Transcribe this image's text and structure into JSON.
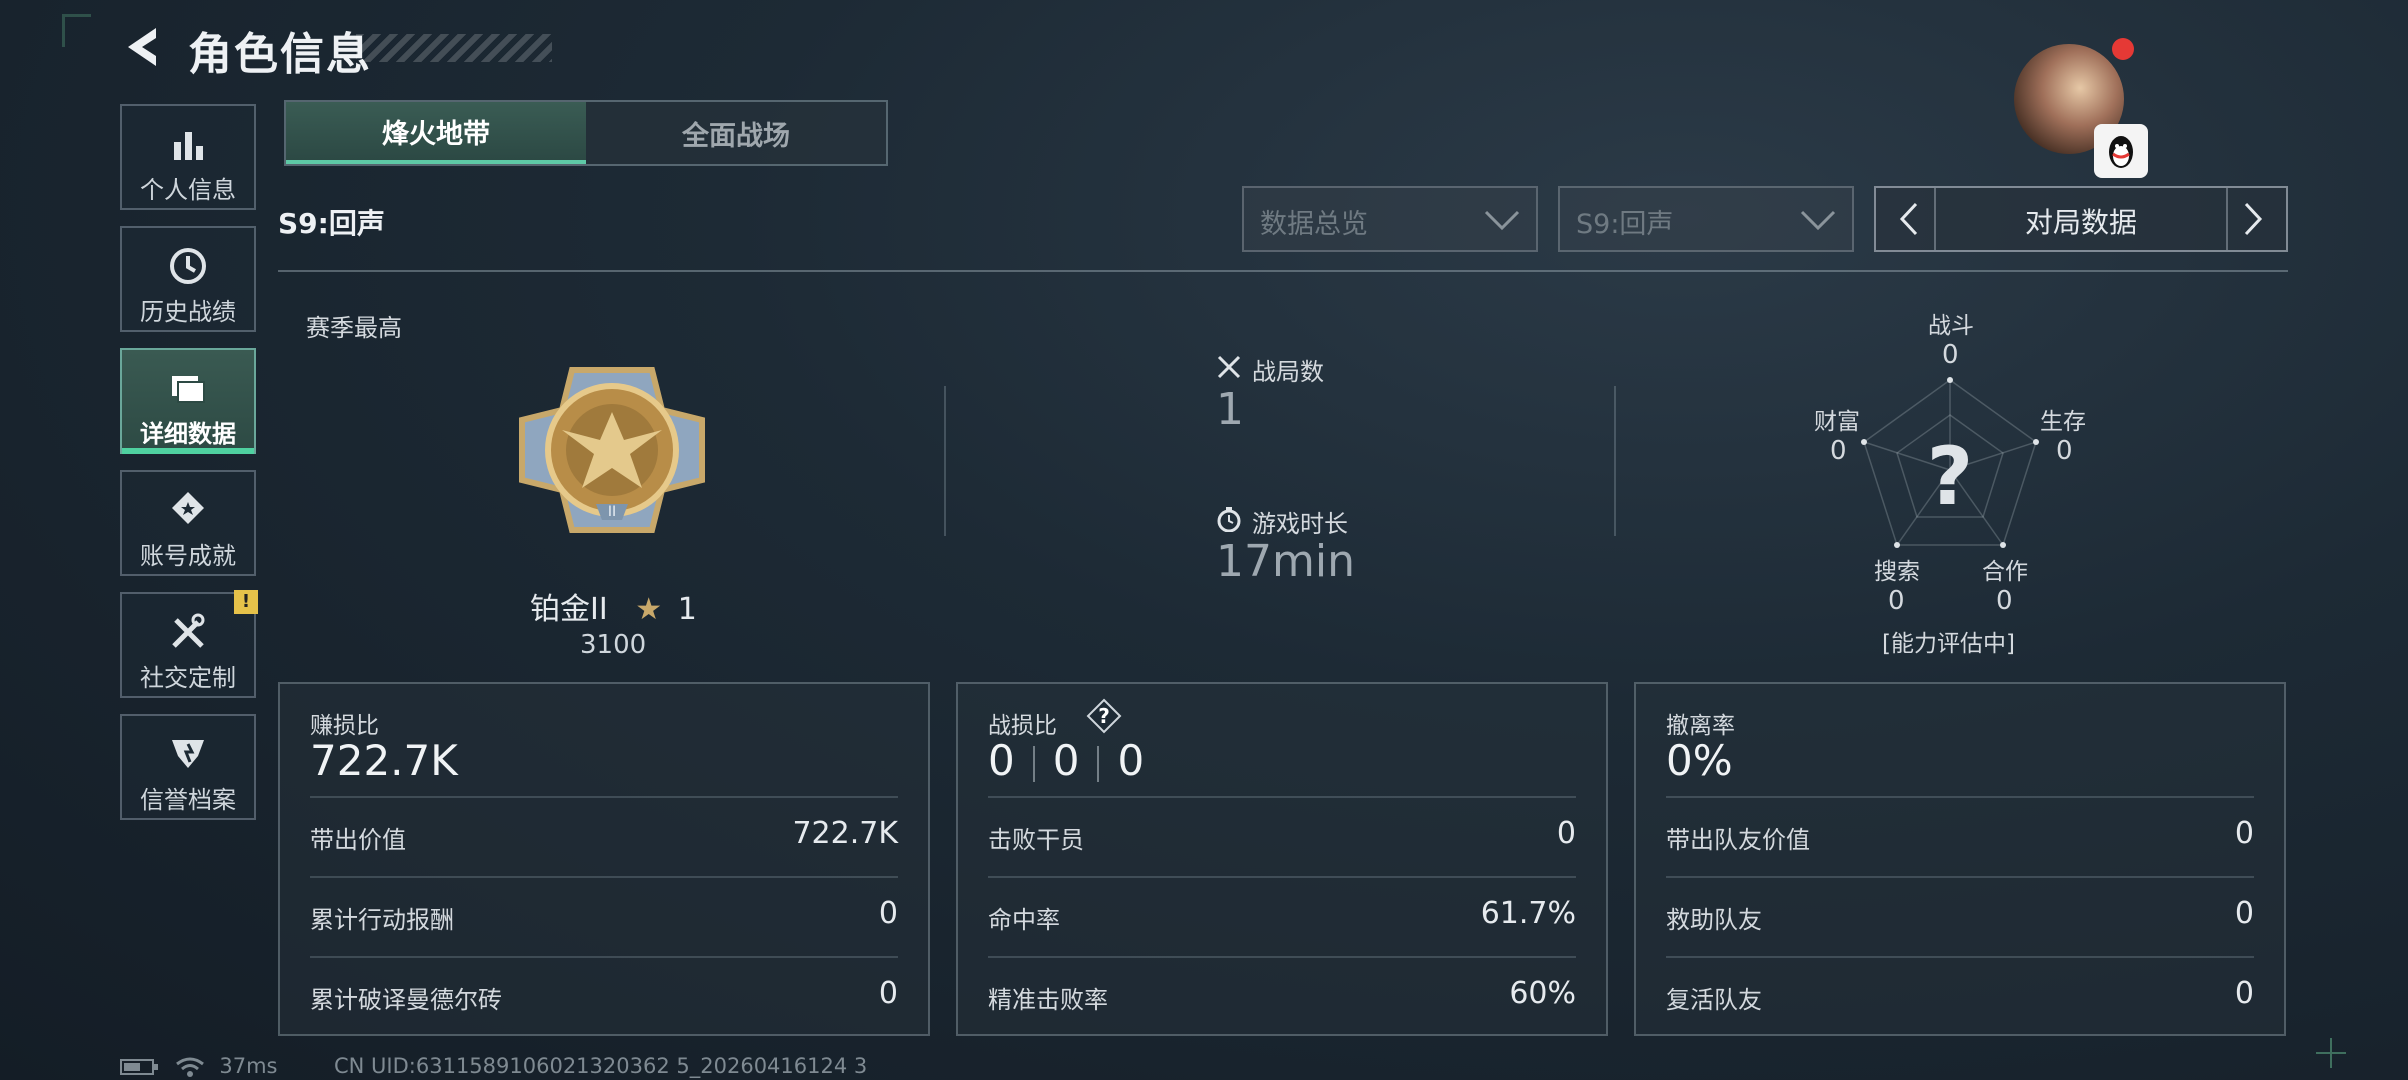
{
  "header": {
    "title": "角色信息"
  },
  "sidebar": {
    "items": [
      {
        "label": "个人信息"
      },
      {
        "label": "历史战绩"
      },
      {
        "label": "详细数据"
      },
      {
        "label": "账号成就"
      },
      {
        "label": "社交定制",
        "badge": "!"
      },
      {
        "label": "信誉档案"
      }
    ]
  },
  "tabs": [
    {
      "label": "烽火地带"
    },
    {
      "label": "全面战场"
    }
  ],
  "filters": {
    "season_label": "S9:回声",
    "dropdown_overview": "数据总览",
    "dropdown_season": "S9:回声",
    "nav_label": "对局数据"
  },
  "season_best": {
    "label": "赛季最高",
    "rank": "铂金II",
    "stars": "1",
    "score": "3100"
  },
  "match_stats": {
    "matches_label": "战局数",
    "matches_value": "1",
    "duration_label": "游戏时长",
    "duration_value": "17min"
  },
  "radar": {
    "combat_label": "战斗",
    "combat_value": "0",
    "survival_label": "生存",
    "survival_value": "0",
    "coop_label": "合作",
    "coop_value": "0",
    "search_label": "搜索",
    "search_value": "0",
    "wealth_label": "财富",
    "wealth_value": "0",
    "center_symbol": "?",
    "status": "[能力评估中]"
  },
  "panels": {
    "profit": {
      "label": "赚损比",
      "value": "722.7K",
      "rows": [
        {
          "k": "带出价值",
          "v": "722.7K"
        },
        {
          "k": "累计行动报酬",
          "v": "0"
        },
        {
          "k": "累计破译曼德尔砖",
          "v": "0"
        }
      ]
    },
    "kd": {
      "label": "战损比",
      "values": [
        "0",
        "0",
        "0"
      ],
      "rows": [
        {
          "k": "击败干员",
          "v": "0"
        },
        {
          "k": "命中率",
          "v": "61.7%"
        },
        {
          "k": "精准击败率",
          "v": "60%"
        }
      ]
    },
    "extract": {
      "label": "撤离率",
      "value": "0%",
      "rows": [
        {
          "k": "带出队友价值",
          "v": "0"
        },
        {
          "k": "救助队友",
          "v": "0"
        },
        {
          "k": "复活队友",
          "v": "0"
        }
      ]
    }
  },
  "footer": {
    "ping": "37ms",
    "uid": "CN UID:6311589106021320362 5_20260416124 3"
  },
  "colors": {
    "accent": "#4fd1a0",
    "badge": "#e6c24a",
    "notify": "#e53935"
  }
}
